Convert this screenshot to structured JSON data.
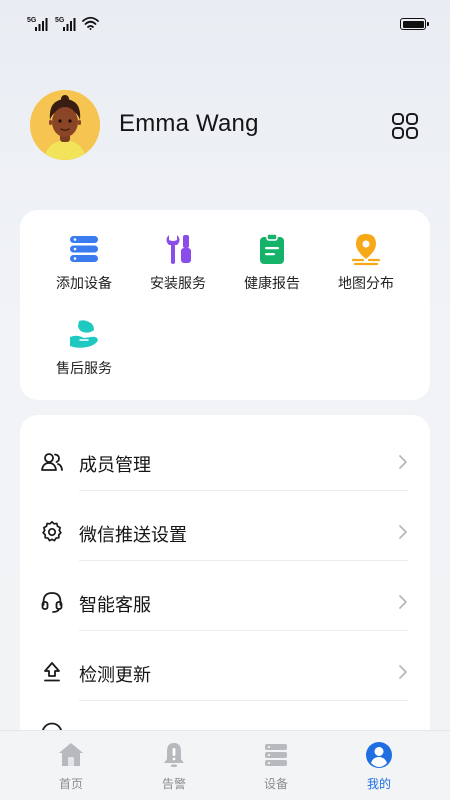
{
  "status_bar": {
    "sim1_label": "5G",
    "sim2_label": "5G",
    "battery_level": 1.0
  },
  "profile": {
    "name": "Emma Wang",
    "avatar_icon": "avatar-illustration-icon",
    "menu_icon": "grid-apps-icon"
  },
  "services": [
    {
      "label": "添加设备",
      "icon": "server-stack-icon",
      "color": "#3a7bf0"
    },
    {
      "label": "安装服务",
      "icon": "tools-icon",
      "color": "#8b4de8"
    },
    {
      "label": "健康报告",
      "icon": "clipboard-icon",
      "color": "#17b26a"
    },
    {
      "label": "地图分布",
      "icon": "map-pin-icon",
      "color": "#f6a817"
    },
    {
      "label": "售后服务",
      "icon": "hand-care-icon",
      "color": "#1fc9c2"
    }
  ],
  "menu": [
    {
      "label": "成员管理",
      "icon": "members-icon"
    },
    {
      "label": "微信推送设置",
      "icon": "gear-icon"
    },
    {
      "label": "智能客服",
      "icon": "headset-icon"
    },
    {
      "label": "检测更新",
      "icon": "upload-arrow-icon"
    }
  ],
  "tabs": [
    {
      "label": "首页",
      "icon": "home-icon",
      "active": false
    },
    {
      "label": "告警",
      "icon": "bell-icon",
      "active": false
    },
    {
      "label": "设备",
      "icon": "device-icon",
      "active": false
    },
    {
      "label": "我的",
      "icon": "user-icon",
      "active": true
    }
  ],
  "colors": {
    "accent": "#1f6fe3",
    "tab_inactive": "#8a8d93",
    "card_bg": "#ffffff",
    "page_bg": "#f2f3f5"
  }
}
